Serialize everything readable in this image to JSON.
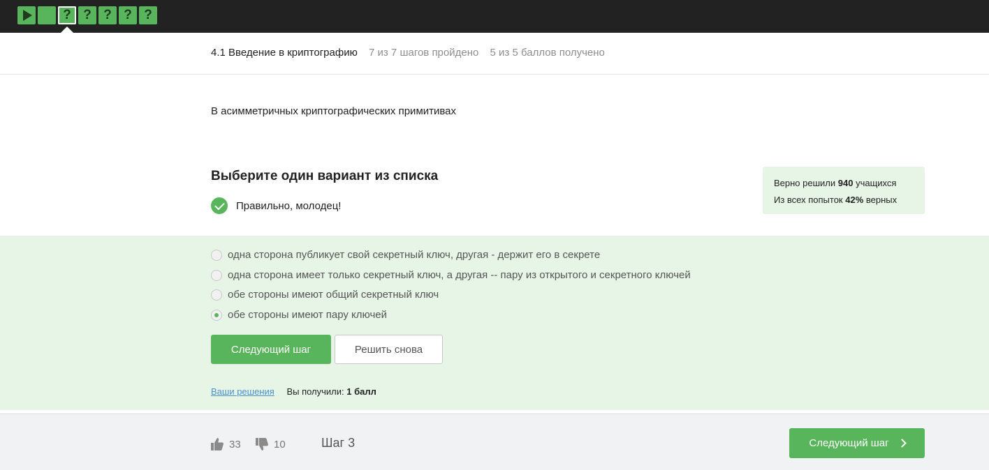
{
  "steps": {
    "items": [
      {
        "icon": "play-icon",
        "label": ""
      },
      {
        "icon": "",
        "label": ""
      },
      {
        "icon": "question-icon",
        "label": "?"
      },
      {
        "icon": "question-icon",
        "label": "?"
      },
      {
        "icon": "question-icon",
        "label": "?"
      },
      {
        "icon": "question-icon",
        "label": "?"
      },
      {
        "icon": "question-icon",
        "label": "?"
      }
    ],
    "active_index": 2
  },
  "lesson": {
    "title": "4.1 Введение в криптографию",
    "steps_progress": "7 из 7 шагов пройдено",
    "score_progress": "5 из 5 баллов  получено"
  },
  "question": {
    "text": "В асимметричных криптографических примитивах"
  },
  "task": {
    "title": "Выберите один вариант из списка",
    "feedback": "Правильно, молодец!"
  },
  "stats": {
    "solved_prefix": "Верно решили ",
    "solved_count": "940",
    "solved_suffix": " учащихся",
    "attempts_prefix": "Из всех попыток ",
    "attempts_percent": "42%",
    "attempts_suffix": " верных"
  },
  "options": [
    {
      "label": "одна сторона публикует свой секретный ключ, другая - держит его в секрете",
      "selected": false
    },
    {
      "label": "одна сторона имеет только секретный ключ, а другая -- пару из открытого и секретного ключей",
      "selected": false
    },
    {
      "label": "обе стороны имеют общий секретный ключ",
      "selected": false
    },
    {
      "label": "обе стороны имеют пару ключей",
      "selected": true
    }
  ],
  "buttons": {
    "next_step": "Следующий шаг",
    "retry": "Решить снова"
  },
  "solutions": {
    "link": "Ваши решения",
    "received_prefix": "Вы получили: ",
    "received_value": "1 балл"
  },
  "footer": {
    "likes": "33",
    "dislikes": "10",
    "step_label": "Шаг 3",
    "next_button": "Следующий шаг"
  },
  "colors": {
    "accent": "#59b55b",
    "topbar": "#222222",
    "answer_bg": "#e7f5e7",
    "footer_bg": "#f1f2f4",
    "link": "#4a90c8"
  }
}
